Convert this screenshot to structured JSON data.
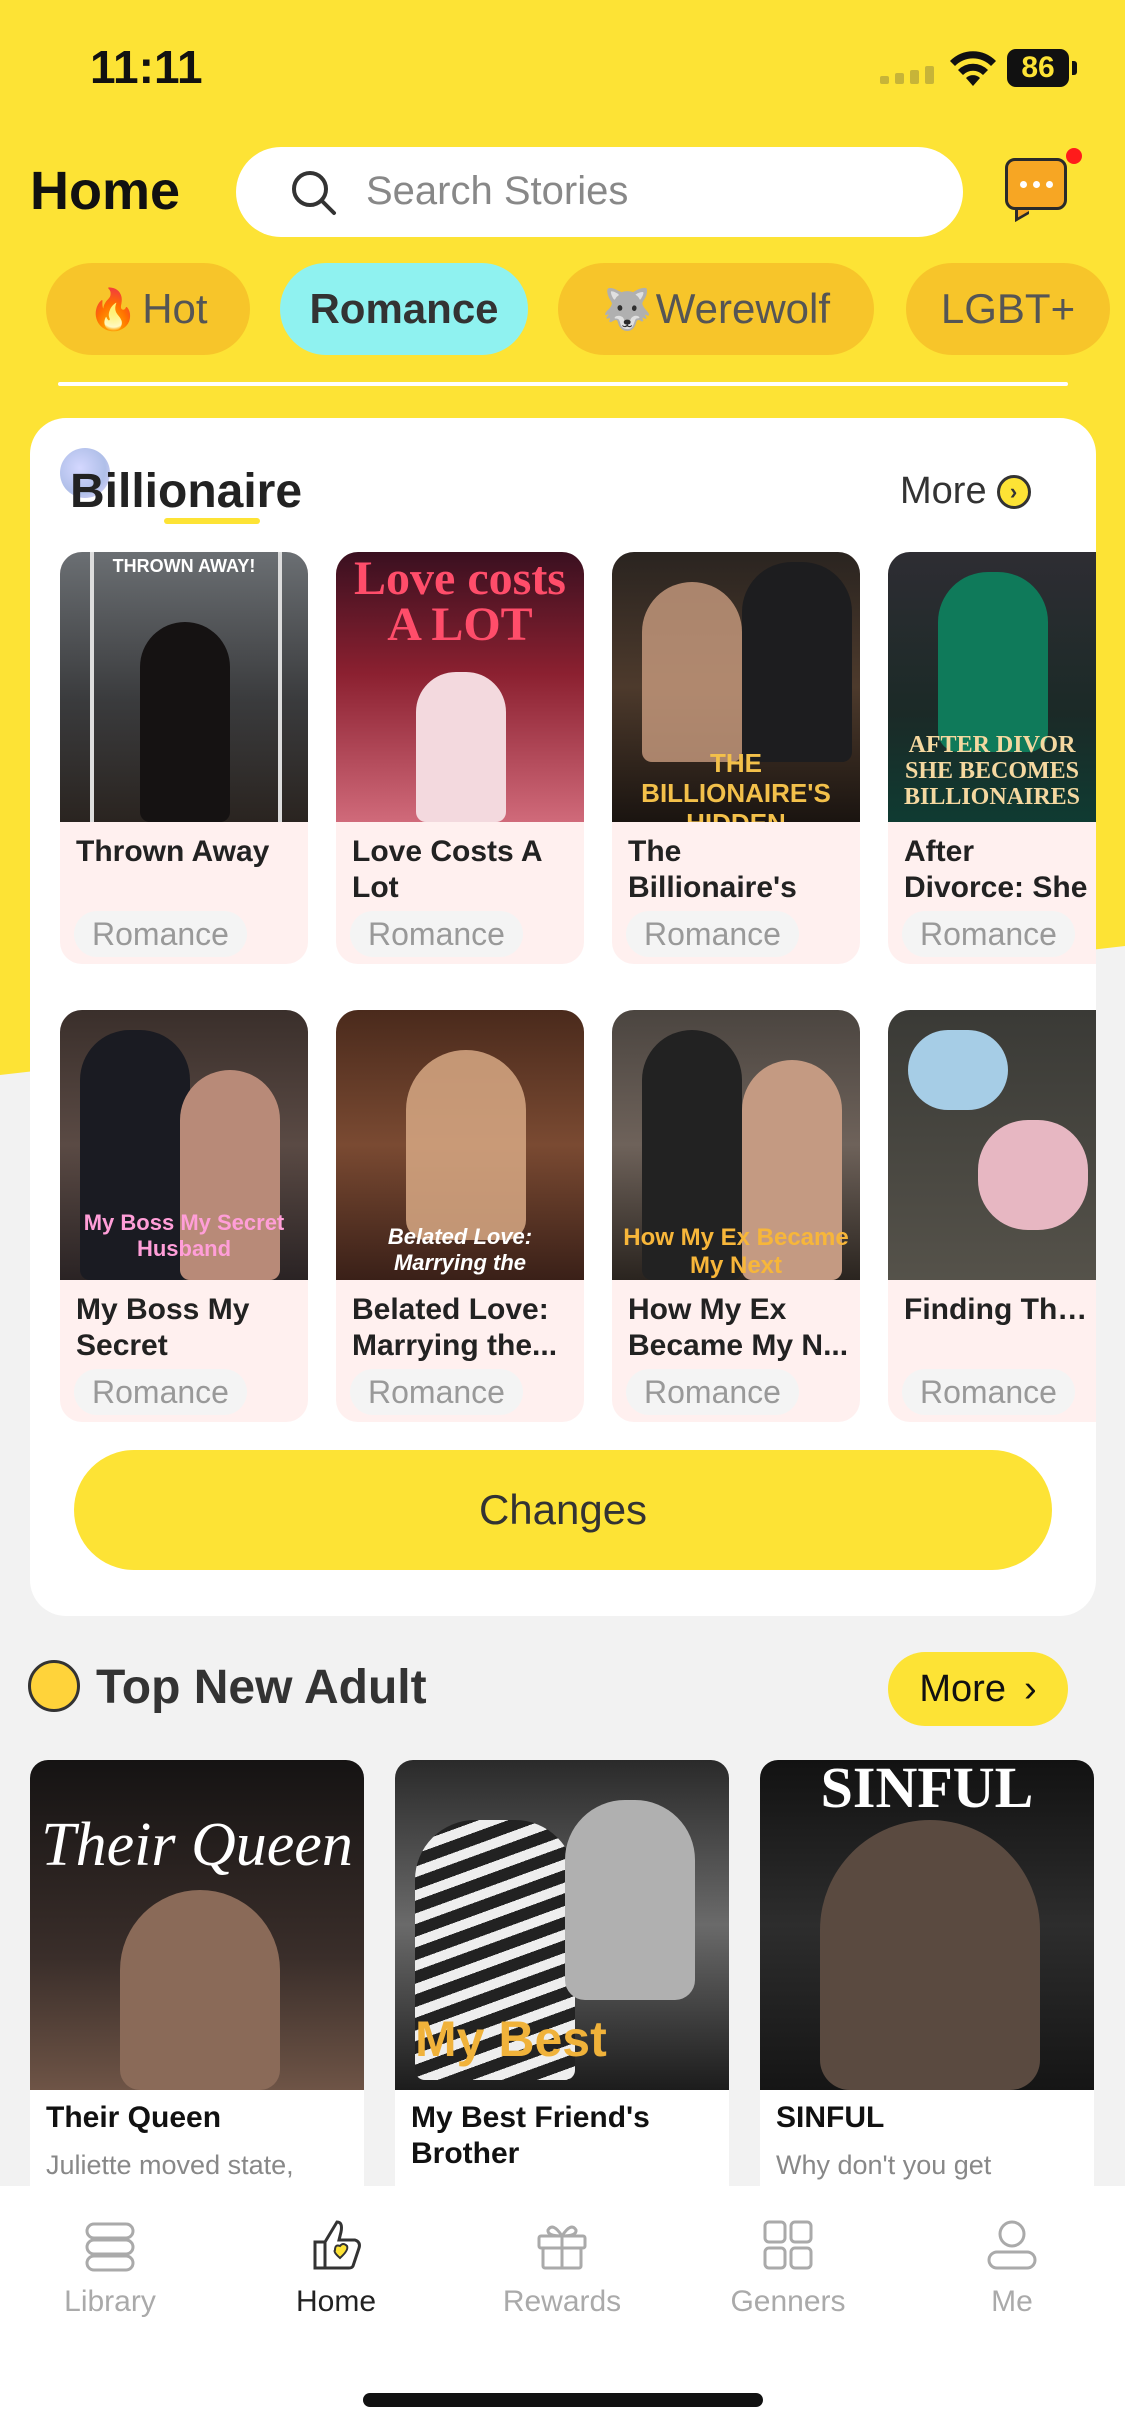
{
  "status_bar": {
    "time": "11:11",
    "battery": "86"
  },
  "header": {
    "title": "Home",
    "search_placeholder": "Search Stories"
  },
  "categories": [
    {
      "label": "Hot",
      "emoji": "🔥"
    },
    {
      "label": "Romance",
      "emoji": ""
    },
    {
      "label": "Werewolf",
      "emoji": "🐺"
    },
    {
      "label": "LGBT+",
      "emoji": ""
    }
  ],
  "billionaire": {
    "title": "Billionaire",
    "more": "More",
    "books": [
      {
        "title": "Thrown Away",
        "genre": "Romance",
        "cover_text": "THROWN AWAY!"
      },
      {
        "title": "Love Costs A Lot",
        "genre": "Romance",
        "cover_text": "Love costs A LOT"
      },
      {
        "title": "The Billionaire's Hidden Heiress",
        "genre": "Romance",
        "cover_text": "THE BILLIONAIRE'S HIDDEN"
      },
      {
        "title": "After Divorce: She Becomes...",
        "genre": "Romance",
        "cover_text": "AFTER DIVOR SHE BECOMES BILLIONAIRES"
      },
      {
        "title": "My Boss My Secret Husband",
        "genre": "Romance",
        "cover_text": "My Boss My Secret Husband"
      },
      {
        "title": "Belated Love: Marrying the...",
        "genre": "Romance",
        "cover_text": "Belated Love: Marrying the"
      },
      {
        "title": "How My Ex Became My N...",
        "genre": "Romance",
        "cover_text": "How My Ex Became My Next"
      },
      {
        "title": "Finding Them",
        "genre": "Romance",
        "cover_text": ""
      }
    ],
    "changes_label": "Changes"
  },
  "top_new_adult": {
    "title": "Top New Adult",
    "more": "More",
    "books": [
      {
        "title": "Their Queen",
        "desc": "Juliette moved state,",
        "cover_text": "Their Queen"
      },
      {
        "title": "My Best Friend's Brother",
        "desc": "",
        "cover_text": "My Best"
      },
      {
        "title": "SINFUL",
        "desc": "Why don't you get",
        "cover_text": "SINFUL"
      }
    ]
  },
  "tabbar": {
    "items": [
      {
        "label": "Library"
      },
      {
        "label": "Home"
      },
      {
        "label": "Rewards"
      },
      {
        "label": "Genners"
      },
      {
        "label": "Me"
      }
    ]
  },
  "colors": {
    "accent": "#fde335",
    "active_chip": "#8ff2f0",
    "chip": "#f7c52a"
  }
}
